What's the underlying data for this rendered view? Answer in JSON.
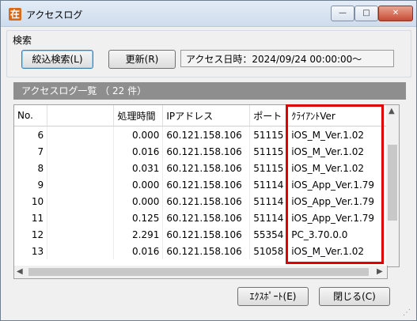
{
  "window": {
    "title": "アクセスログ",
    "icon_char": "在",
    "close_glyph": "✕",
    "min_glyph": "—",
    "max_glyph": "□"
  },
  "search": {
    "group_label": "検索",
    "filter_button": "絞込検索(L)",
    "refresh_button": "更新(R)",
    "date_text": "アクセス日時：2024/09/24 00:00:00～"
  },
  "list": {
    "header": "アクセスログ一覧 （ 22 件）",
    "columns": [
      "No.",
      "",
      "処理時間",
      "IPアドレス",
      "ポート",
      "ｸﾗｲｱﾝﾄVer"
    ],
    "rows": [
      [
        "6",
        "",
        "0.000",
        "60.121.158.106",
        "51115",
        "iOS_M_Ver.1.02"
      ],
      [
        "7",
        "",
        "0.016",
        "60.121.158.106",
        "51115",
        "iOS_M_Ver.1.02"
      ],
      [
        "8",
        "",
        "0.031",
        "60.121.158.106",
        "51115",
        "iOS_M_Ver.1.02"
      ],
      [
        "9",
        "",
        "0.000",
        "60.121.158.106",
        "51114",
        "iOS_App_Ver.1.79"
      ],
      [
        "10",
        "",
        "0.000",
        "60.121.158.106",
        "51114",
        "iOS_App_Ver.1.79"
      ],
      [
        "11",
        "",
        "0.125",
        "60.121.158.106",
        "51114",
        "iOS_App_Ver.1.79"
      ],
      [
        "12",
        "",
        "2.291",
        "60.121.158.106",
        "55354",
        "PC_3.70.0.0"
      ],
      [
        "13",
        "",
        "0.016",
        "60.121.158.106",
        "51058",
        "iOS_M_Ver.1.02"
      ]
    ]
  },
  "footer": {
    "export_button": "ｴｸｽﾎﾟｰﾄ(E)",
    "close_button": "閉じる(C)"
  },
  "colors": {
    "highlight": "#e00000",
    "header_bg": "#8e8e8e"
  }
}
